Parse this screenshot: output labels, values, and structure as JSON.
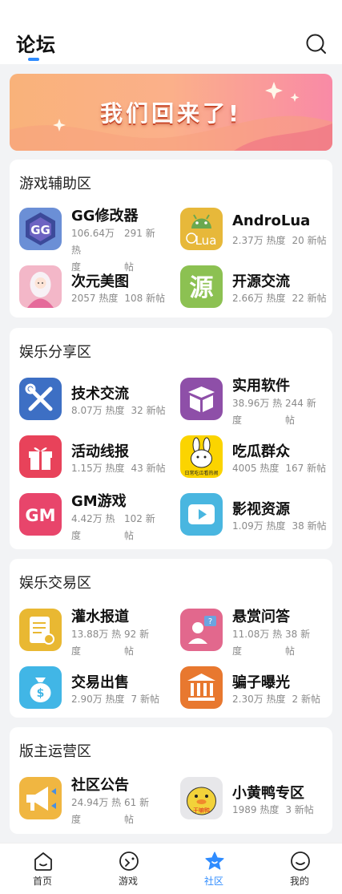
{
  "header": {
    "title": "论坛"
  },
  "banner": {
    "text": "我们回来了!"
  },
  "sections": [
    {
      "title": "游戏辅助区",
      "items": [
        {
          "name": "GG修改器",
          "heat": "106.64万 热度",
          "posts": "291 新帖",
          "heat_a": "106.64万 热",
          "heat_b": "度",
          "posts_a": "291 新",
          "posts_b": "帖",
          "icon": "gg-icon"
        },
        {
          "name": "AndroLua",
          "heat": "2.37万 热度",
          "posts": "20 新帖",
          "icon": "androlua-icon"
        },
        {
          "name": "次元美图",
          "heat": "2057 热度",
          "posts": "108 新帖",
          "icon": "anime-girl-icon"
        },
        {
          "name": "开源交流",
          "heat": "2.66万 热度",
          "posts": "22 新帖",
          "icon": "source-icon",
          "icon_text": "源"
        }
      ]
    },
    {
      "title": "娱乐分享区",
      "items": [
        {
          "name": "技术交流",
          "heat": "8.07万 热度",
          "posts": "32 新帖",
          "icon": "tools-icon"
        },
        {
          "name": "实用软件",
          "heat_a": "38.96万 热",
          "heat_b": "度",
          "posts_a": "244 新",
          "posts_b": "帖",
          "icon": "box-icon"
        },
        {
          "name": "活动线报",
          "heat": "1.15万 热度",
          "posts": "43 新帖",
          "icon": "gift-icon"
        },
        {
          "name": "吃瓜群众",
          "heat": "4005 热度",
          "posts": "167 新帖",
          "icon": "rabbit-icon",
          "icon_text": "日常吃瓜看热闹"
        },
        {
          "name": "GM游戏",
          "heat_a": "4.42万 热",
          "heat_b": "度",
          "posts_a": "102 新",
          "posts_b": "帖",
          "icon": "gm-icon",
          "icon_text": "GM"
        },
        {
          "name": "影视资源",
          "heat": "1.09万 热度",
          "posts": "38 新帖",
          "icon": "video-play-icon"
        }
      ]
    },
    {
      "title": "娱乐交易区",
      "items": [
        {
          "name": "灌水报道",
          "heat_a": "13.88万 热",
          "heat_b": "度",
          "posts_a": "92 新",
          "posts_b": "帖",
          "icon": "document-clock-icon"
        },
        {
          "name": "悬赏问答",
          "heat_a": "11.08万 热",
          "heat_b": "度",
          "posts_a": "38 新",
          "posts_b": "帖",
          "icon": "question-user-icon"
        },
        {
          "name": "交易出售",
          "heat": "2.90万 热度",
          "posts": "7 新帖",
          "icon": "money-bag-icon"
        },
        {
          "name": "骗子曝光",
          "heat": "2.30万 热度",
          "posts": "2 新帖",
          "icon": "bank-icon"
        }
      ]
    },
    {
      "title": "版主运营区",
      "items": [
        {
          "name": "社区公告",
          "heat_a": "24.94万 热",
          "heat_b": "度",
          "posts_a": "61 新",
          "posts_b": "帖",
          "icon": "megaphone-icon"
        },
        {
          "name": "小黄鸭专区",
          "heat": "1989 热度",
          "posts": "3 新帖",
          "icon": "duck-icon",
          "icon_text": "干嘛鸭"
        }
      ]
    }
  ],
  "tabbar": [
    {
      "label": "首页",
      "icon": "home-icon",
      "active": false
    },
    {
      "label": "游戏",
      "icon": "game-icon",
      "active": false
    },
    {
      "label": "社区",
      "icon": "star-icon",
      "active": true
    },
    {
      "label": "我的",
      "icon": "profile-icon",
      "active": false
    }
  ],
  "colors": {
    "accent": "#2f8cff",
    "text_secondary": "#8a8a8a",
    "background": "#f2f3f5"
  }
}
